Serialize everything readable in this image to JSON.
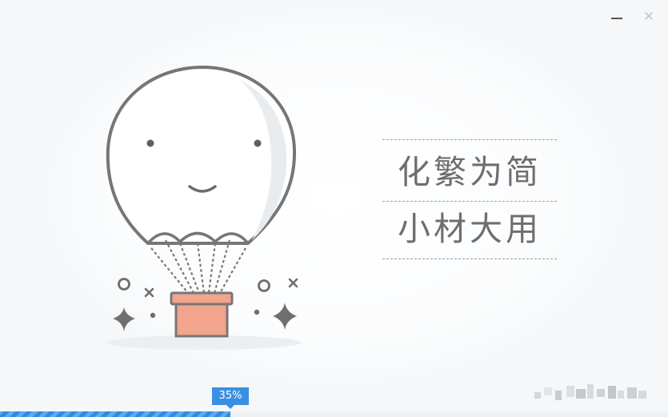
{
  "window": {
    "background": "#f5f7f9",
    "controls": {
      "minimize": "minimize-icon",
      "close_glyph": "✕"
    }
  },
  "illustration": {
    "subject": "hot-air-balloon-icon",
    "basket_color": "#f2a48c",
    "outline_color": "#6f6f6f"
  },
  "slogan": {
    "line1": "化繁为简",
    "line2": "小材大用"
  },
  "progress": {
    "percent": 35,
    "label": "35%",
    "bar_color": "#2e8be0",
    "label_color": "#3a8fe4"
  }
}
